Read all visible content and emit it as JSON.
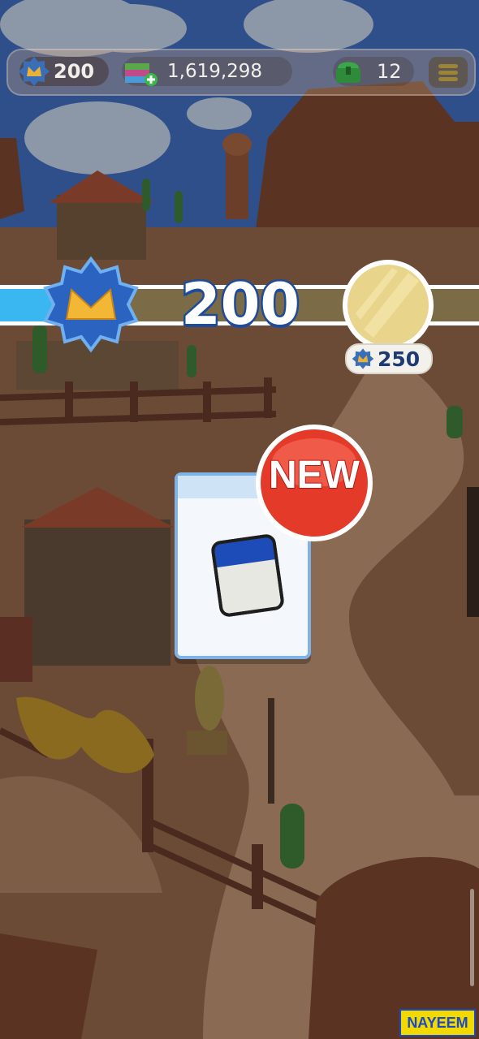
{
  "hud": {
    "stars": "200",
    "cash": "1,619,298",
    "chests": "12",
    "icons": {
      "stars": "star-badge-icon",
      "cash": "cash-stack-icon",
      "add": "plus-icon",
      "chest": "green-chest-icon",
      "menu": "hamburger-menu-icon"
    }
  },
  "level_bar": {
    "level": "200",
    "progress_fraction": 0.19,
    "reward_cost": "250",
    "icons": {
      "level": "level-badge-icon",
      "reward": "gold-coin-icon"
    }
  },
  "popup": {
    "new_label": "NEW",
    "card_icon": "blank-card-icon"
  },
  "watermark": "NAYEEM",
  "colors": {
    "progress_fill": "#3ab7f0",
    "badge_red": "#e43a2a",
    "level_text_outline": "#1d4b9a",
    "watermark_bg": "#f2d900"
  }
}
